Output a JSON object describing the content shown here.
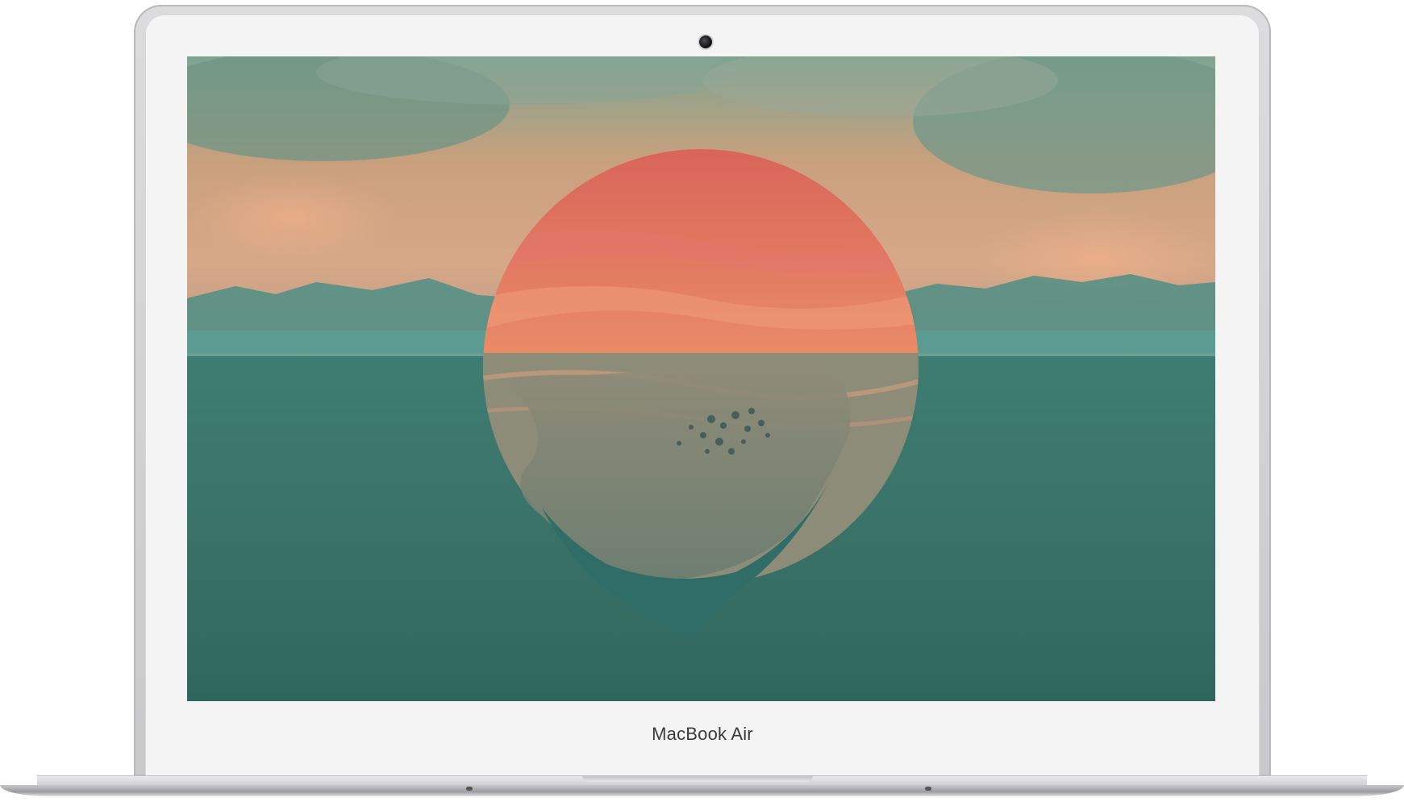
{
  "device": {
    "brand_label": "MacBook Air"
  },
  "wallpaper": {
    "icons": [
      "sun-disc-icon",
      "floating-island-icon"
    ],
    "colors": {
      "sky": "#c99a78",
      "cloud": "#6f9a8a",
      "sun": "#e07a5f",
      "sea": "#3a7a6e",
      "horizon": "#57a29a"
    }
  }
}
